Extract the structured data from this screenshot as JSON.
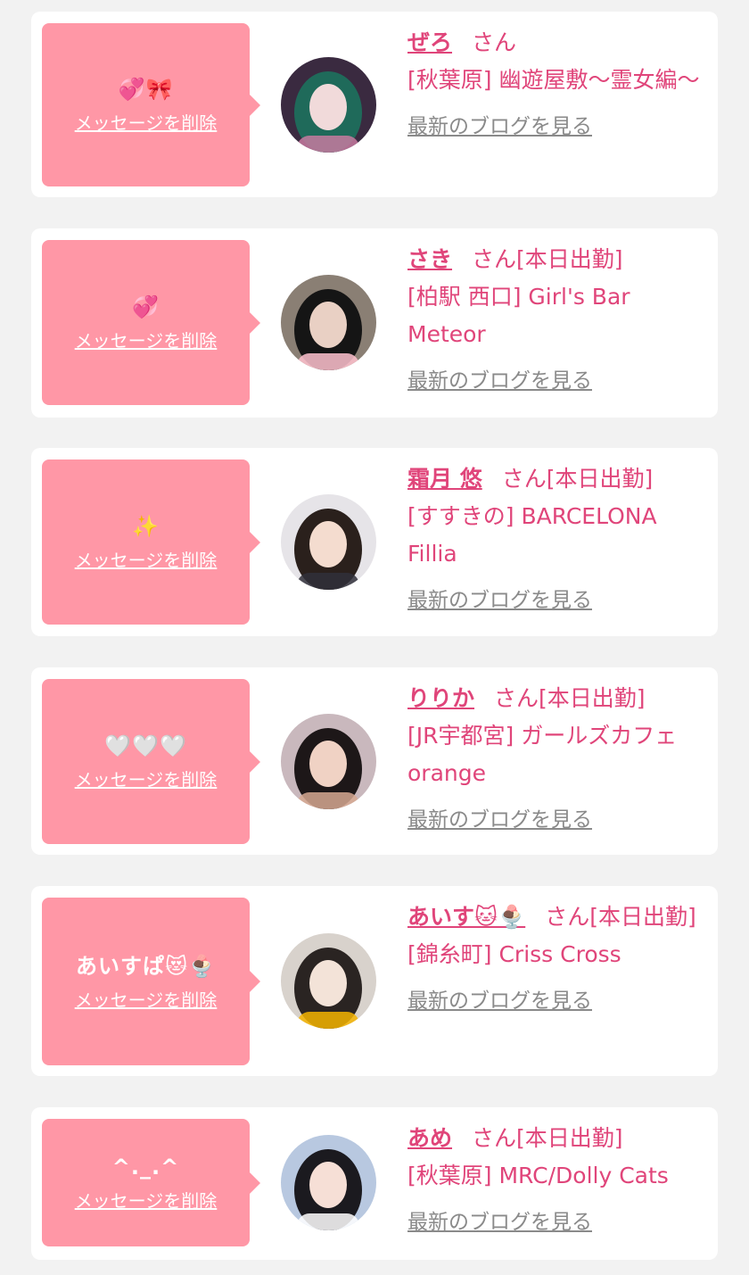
{
  "favorites": [
    {
      "bubble_message": "💞🎀",
      "delete_label": "メッセージを削除",
      "name": "ぜろ",
      "suffix": "さん",
      "status": "",
      "shop": "[秋葉原] 幽遊屋敷〜霊女編〜",
      "blog_label": "最新のブログを見る",
      "avatar": {
        "bg": "#3a2a40",
        "hair": "#1f6a5a",
        "skin": "#f1dada",
        "accent": "#c77aa0"
      }
    },
    {
      "bubble_message": "💞",
      "delete_label": "メッセージを削除",
      "name": "さき",
      "suffix": "さん",
      "status": "[本日出勤]",
      "shop": "[柏駅 西口] Girl's Bar Meteor",
      "blog_label": "最新のブログを見る",
      "avatar": {
        "bg": "#8a7f74",
        "hair": "#151515",
        "skin": "#e9d0c4",
        "accent": "#ffc2cf"
      }
    },
    {
      "bubble_message": "✨",
      "delete_label": "メッセージを削除",
      "name": "霜月 悠",
      "suffix": "さん",
      "status": "[本日出勤]",
      "shop": "[すすきの] BARCELONA Fillia",
      "blog_label": "最新のブログを見る",
      "avatar": {
        "bg": "#e6e4e8",
        "hair": "#2a201c",
        "skin": "#f4dccf",
        "accent": "#30303a"
      }
    },
    {
      "bubble_message": "🤍🤍🤍",
      "delete_label": "メッセージを削除",
      "name": "りりか",
      "suffix": "さん",
      "status": "[本日出勤]",
      "shop": "[JR宇都宮] ガールズカフェ orange",
      "blog_label": "最新のブログを見る",
      "avatar": {
        "bg": "#c9b8bd",
        "hair": "#1d1718",
        "skin": "#f0d2c4",
        "accent": "#d6a892"
      }
    },
    {
      "bubble_message": "あいすぱ😻🍨",
      "delete_label": "メッセージを削除",
      "name": "あいす🐱🍨",
      "suffix": "さん",
      "status": "[本日出勤]",
      "shop": "[錦糸町] Criss Cross",
      "blog_label": "最新のブログを見る",
      "avatar": {
        "bg": "#d8d2cc",
        "hair": "#2a2422",
        "skin": "#f3e3d8",
        "accent": "#f5b400"
      }
    },
    {
      "bubble_message": "^._.^",
      "delete_label": "メッセージを削除",
      "name": "あめ",
      "suffix": "さん",
      "status": "[本日出勤]",
      "shop": "[秋葉原] MRC/Dolly Cats",
      "blog_label": "最新のブログを見る",
      "avatar": {
        "bg": "#b8c8e0",
        "hair": "#1b1a1f",
        "skin": "#f6dfd6",
        "accent": "#ffffff"
      }
    }
  ]
}
